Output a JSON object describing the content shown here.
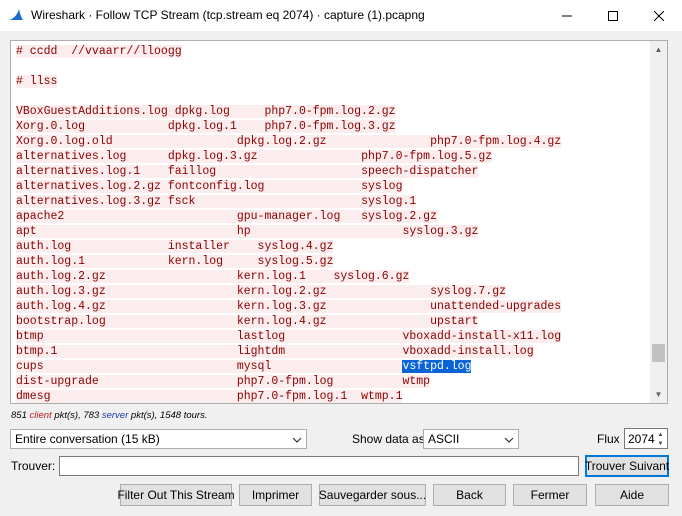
{
  "window": {
    "title": "Wireshark · Follow TCP Stream (tcp.stream eq 2074) · capture (1).pcapng",
    "controls": {
      "minimize": "minimize",
      "maximize": "maximize",
      "close": "close"
    }
  },
  "stream": {
    "lines": [
      {
        "segs": [
          "# ccdd  //vvaarr//lloogg"
        ]
      },
      {
        "segs": []
      },
      {
        "segs": [
          "# llss"
        ]
      },
      {
        "segs": []
      },
      {
        "segs": [
          "VBoxGuestAdditions.log dpkg.log     php7.0-fpm.log.2.gz"
        ]
      },
      {
        "segs": [
          "Xorg.0.log            dpkg.log.1    php7.0-fpm.log.3.gz"
        ]
      },
      {
        "segs": [
          "Xorg.0.log.old                  dpkg.log.2.gz",
          "               php7.0-fpm.log.4.gz"
        ]
      },
      {
        "segs": [
          "alternatives.log      dpkg.log.3.gz",
          "               php7.0-fpm.log.5.gz"
        ]
      },
      {
        "segs": [
          "alternatives.log.1    faillog",
          "                     speech-dispatcher"
        ]
      },
      {
        "segs": [
          "alternatives.log.2.gz fontconfig.log",
          "              syslog"
        ]
      },
      {
        "segs": [
          "alternatives.log.3.gz fsck",
          "                        syslog.1"
        ]
      },
      {
        "segs": [
          "apache2                         gpu-manager.log",
          "   syslog.2.gz"
        ]
      },
      {
        "segs": [
          "apt                             hp",
          "                      syslog.3.gz"
        ]
      },
      {
        "segs": [
          "auth.log              installer",
          "    syslog.4.gz"
        ]
      },
      {
        "segs": [
          "auth.log.1            kern.log",
          "     syslog.5.gz"
        ]
      },
      {
        "segs": [
          "auth.log.2.gz                   kern.log.1",
          "    syslog.6.gz"
        ]
      },
      {
        "segs": [
          "auth.log.3.gz                   kern.log.2.gz",
          "               syslog.7.gz"
        ]
      },
      {
        "segs": [
          "auth.log.4.gz                   kern.log.3.gz",
          "               unattended-upgrades"
        ]
      },
      {
        "segs": [
          "bootstrap.log                   kern.log.4.gz",
          "               upstart"
        ]
      },
      {
        "segs": [
          "btmp                            lastlog",
          "                 vboxadd-install-x11.log"
        ]
      },
      {
        "segs": [
          "btmp.1                          lightdm",
          "                 vboxadd-install.log"
        ]
      },
      {
        "segs": [
          "cups                            mysql",
          "                   "
        ],
        "selected": "vsftpd.log"
      },
      {
        "segs": [
          "dist-upgrade                    php7.0-fpm.log",
          "          wtmp"
        ]
      },
      {
        "segs": [
          "dmesg                           php7.0-fpm.log.1",
          "  wtmp.1"
        ]
      }
    ]
  },
  "stats": {
    "client_count": "851",
    "client_word": "client",
    "mid_text": " pkt(s), ",
    "server_count": "783",
    "server_word": "server",
    "tail_text": " pkt(s), 1548 tours."
  },
  "controls": {
    "conversation_select": "Entire conversation (15 kB)",
    "show_data_label": "Show data as",
    "show_data_value": "ASCII",
    "flux_label": "Flux",
    "flux_value": "2074",
    "find_label": "Trouver:",
    "find_value": "",
    "find_next_button": "Trouver Suivant"
  },
  "buttons": {
    "filter_out": "Filter Out This Stream",
    "print": "Imprimer",
    "save_as": "Sauvegarder sous...",
    "back": "Back",
    "close": "Fermer",
    "help": "Aide"
  },
  "colors": {
    "client_text": "#8b0000",
    "client_bg": "#fbeded",
    "selection": "#0a64d6"
  },
  "icons": {
    "app": "wireshark-fin-icon",
    "dropdown": "chevron-down-icon"
  }
}
